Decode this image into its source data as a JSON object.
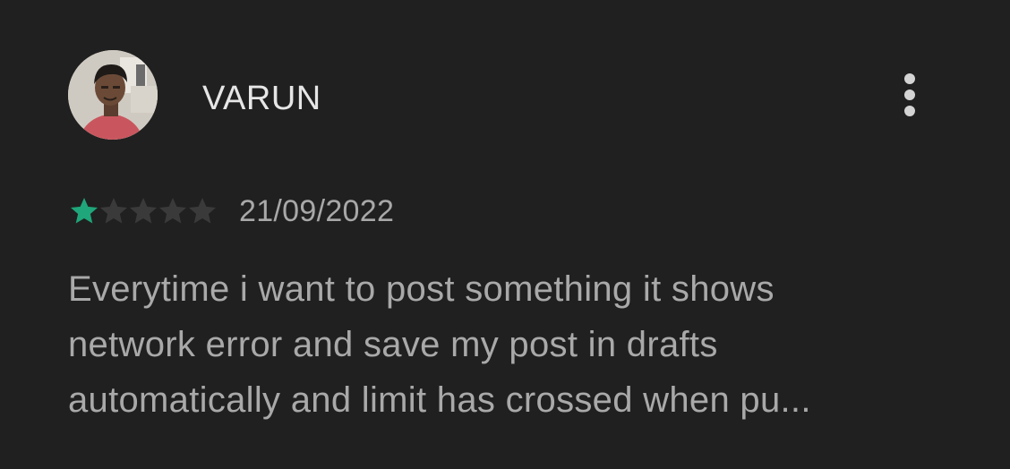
{
  "review": {
    "reviewer_name": "VARUN",
    "menu_icon": "more-vert-icon",
    "rating": 1,
    "max_rating": 5,
    "date": "21/09/2022",
    "text_lines": [
      "Everytime i want to post something it shows",
      "network error and save my post in drafts",
      "automatically and limit has crossed when pu..."
    ]
  },
  "colors": {
    "background": "#202020",
    "star_filled": "#1fa67a",
    "star_empty": "#3a3a3a",
    "name_text": "#e6e6e6",
    "secondary_text": "#a9a9a9"
  }
}
